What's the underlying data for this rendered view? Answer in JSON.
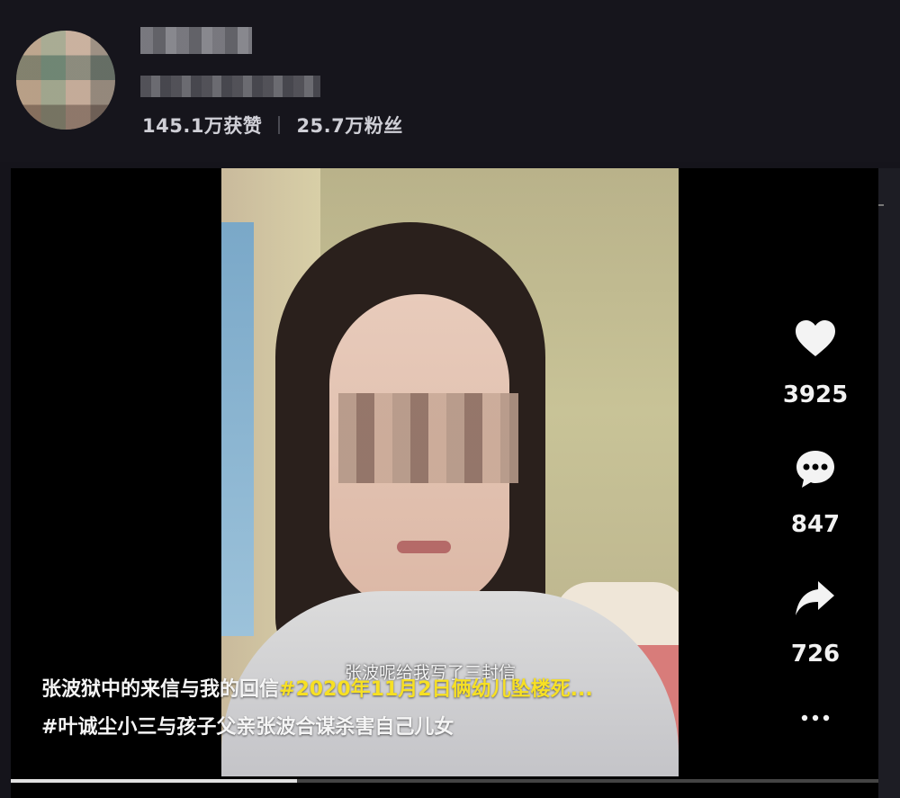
{
  "profile": {
    "stats": {
      "likes": "145.1万获赞",
      "fans": "25.7万粉丝"
    }
  },
  "video": {
    "subtitle": "张波呢给我写了三封信",
    "caption_plain": "张波狱中的来信与我的回信",
    "caption_tag1": "#2020年11月2日俩幼儿坠楼死...",
    "caption_tag2": "#叶诚尘小三与孩子父亲张波合谋杀害自己儿女",
    "progress": 0.33
  },
  "actions": {
    "likes": "3925",
    "comments": "847",
    "shares": "726",
    "icons": [
      "heart-icon",
      "comment-icon",
      "share-icon",
      "more-icon"
    ]
  }
}
